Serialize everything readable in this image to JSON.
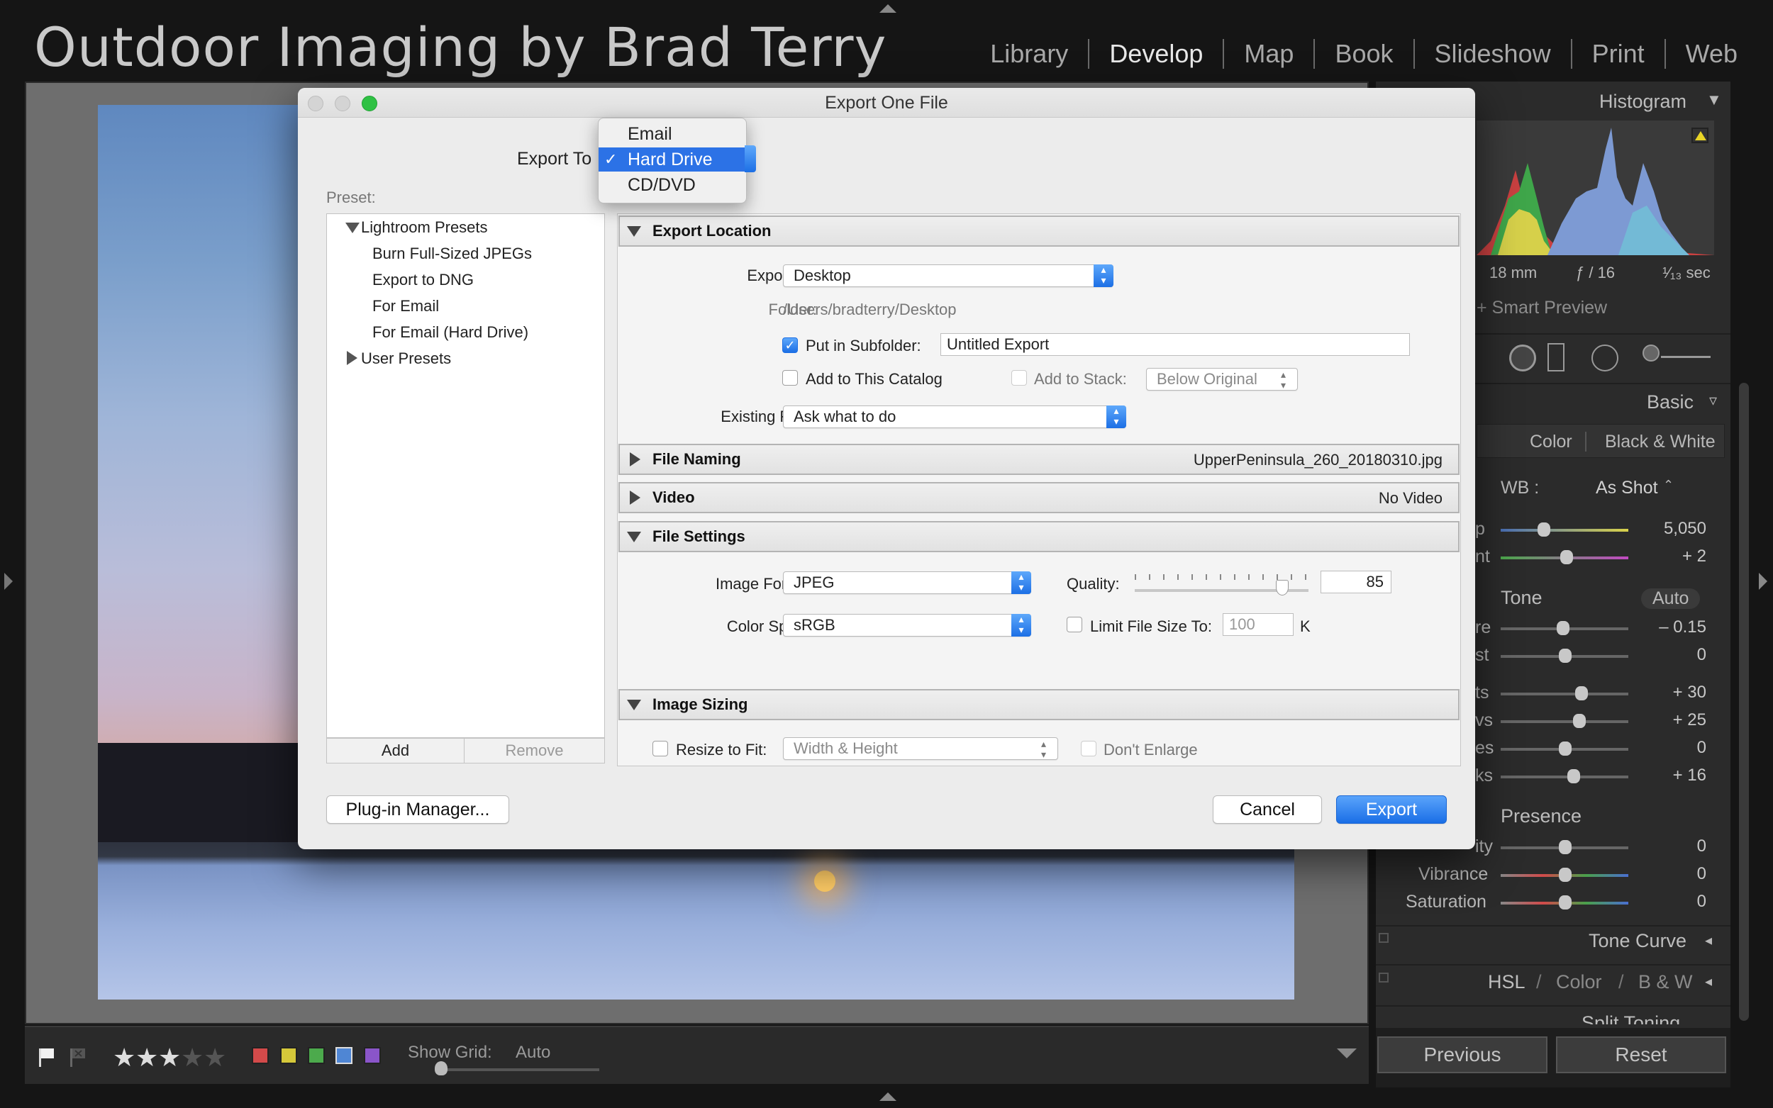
{
  "brand": "Outdoor Imaging by Brad Terry",
  "modules": [
    "Library",
    "Develop",
    "Map",
    "Book",
    "Slideshow",
    "Print",
    "Web"
  ],
  "toolbar": {
    "show_grid_label": "Show Grid:",
    "show_grid_value": "Auto"
  },
  "right_panel": {
    "histogram_title": "Histogram",
    "focal_length": "18 mm",
    "aperture": "ƒ / 16",
    "shutter": "¹⁄₁₃ sec",
    "smart_preview": "+ Smart Preview",
    "basic_title": "Basic",
    "treatment_color": "Color",
    "treatment_bw": "Black & White",
    "wb_label": "WB :",
    "wb_value": "As Shot",
    "temp_label": "p",
    "temp_value": "5,050",
    "tint_label": "nt",
    "tint_value": "+ 2",
    "tone_label": "Tone",
    "auto_label": "Auto",
    "exposure_label": "re",
    "exposure_value": "– 0.15",
    "contrast_label": "st",
    "contrast_value": "0",
    "highlights_label": "ts",
    "highlights_value": "+ 30",
    "shadows_label": "vs",
    "shadows_value": "+ 25",
    "whites_label": "es",
    "whites_value": "0",
    "blacks_label": "ks",
    "blacks_value": "+ 16",
    "presence_label": "Presence",
    "clarity_label": "ity",
    "clarity_value": "0",
    "vibrance_label": "Vibrance",
    "vibrance_value": "0",
    "saturation_label": "Saturation",
    "saturation_value": "0",
    "tone_curve": "Tone Curve",
    "hsl": "HSL",
    "hsl_sep1": "/",
    "hsl_color": "Color",
    "hsl_sep2": "/",
    "hsl_bw": "B & W",
    "split_toning": "Split Toning",
    "previous_button": "Previous",
    "reset_button": "Reset"
  },
  "dialog": {
    "title": "Export One File",
    "export_to_label": "Export To",
    "popup_options": [
      "Email",
      "Hard Drive",
      "CD/DVD"
    ],
    "popup_checkmark": "✓",
    "preset_label": "Preset:",
    "presets": {
      "lightroom_group": "Lightroom Presets",
      "items": [
        "Burn Full-Sized JPEGs",
        "Export to DNG",
        "For Email",
        "For Email (Hard Drive)"
      ],
      "user_group": "User Presets"
    },
    "add_button": "Add",
    "remove_button": "Remove",
    "export_location": {
      "title": "Export Location",
      "export_to_label": "Export To:",
      "export_to_value": "Desktop",
      "folder_label": "Folder:",
      "folder_value": "/Users/bradterry/Desktop",
      "subfolder_label": "Put in Subfolder:",
      "subfolder_value": "Untitled Export",
      "add_catalog_label": "Add to This Catalog",
      "add_stack_label": "Add to Stack:",
      "stack_value": "Below Original",
      "existing_label": "Existing Files:",
      "existing_value": "Ask what to do"
    },
    "file_naming": {
      "title": "File Naming",
      "summary": "UpperPeninsula_260_20180310.jpg"
    },
    "video": {
      "title": "Video",
      "summary": "No Video"
    },
    "file_settings": {
      "title": "File Settings",
      "format_label": "Image Format:",
      "format_value": "JPEG",
      "quality_label": "Quality:",
      "quality_value": "85",
      "colorspace_label": "Color Space:",
      "colorspace_value": "sRGB",
      "limit_label": "Limit File Size To:",
      "limit_value": "100",
      "limit_unit": "K"
    },
    "image_sizing": {
      "title": "Image Sizing",
      "resize_label": "Resize to Fit:",
      "resize_value": "Width & Height",
      "dont_enlarge": "Don't Enlarge"
    },
    "plugin_button": "Plug-in Manager...",
    "cancel_button": "Cancel",
    "export_button": "Export"
  },
  "colors": {
    "accent": "#1c6fe5",
    "panel": "#2b2b2b"
  }
}
